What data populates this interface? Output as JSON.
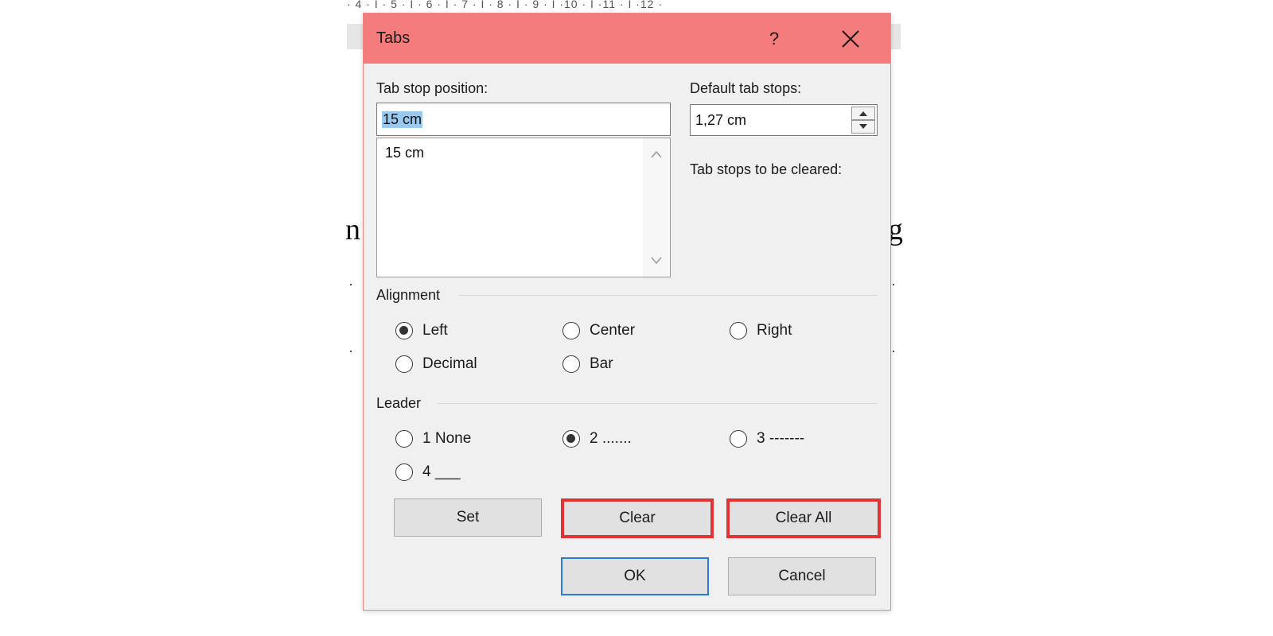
{
  "background": {
    "ruler_text": "· 4 · I · 5 · I · 6 · I · 7 · I · 8 · I · 9 · I ·10 · I ·11 · I ·12 ·",
    "left_fragment": "n",
    "right_fragment": "g"
  },
  "dialog": {
    "title": "Tabs",
    "help_glyph": "?",
    "tab_stop_position_label": "Tab stop position:",
    "tab_stop_position_value": "15 cm",
    "tab_stop_list": [
      "15 cm"
    ],
    "default_tab_stops_label": "Default tab stops:",
    "default_tab_stops_value": "1,27 cm",
    "tab_stops_cleared_label": "Tab stops to be cleared:",
    "alignment": {
      "label": "Alignment",
      "options": [
        "Left",
        "Center",
        "Right",
        "Decimal",
        "Bar"
      ],
      "selected": "Left"
    },
    "leader": {
      "label": "Leader",
      "options": [
        "1 None",
        "2 .......",
        "3 -------",
        "4 ___"
      ],
      "selected": "2 ......."
    },
    "buttons": {
      "set": "Set",
      "clear": "Clear",
      "clear_all": "Clear All",
      "ok": "OK",
      "cancel": "Cancel"
    },
    "colors": {
      "titlebar": "#f47c7c",
      "highlight": "#e23434",
      "default_button_border": "#2a7bd6"
    }
  }
}
